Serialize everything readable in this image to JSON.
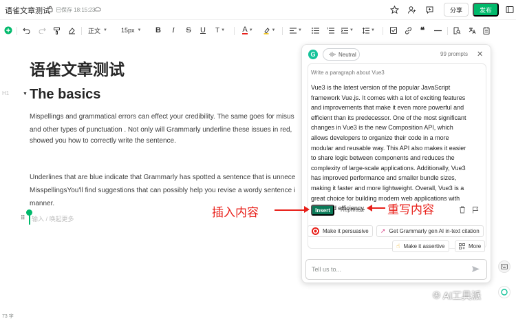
{
  "topbar": {
    "doc_title": "语雀文章测试",
    "saved_label": "已保存 18:15:23",
    "share_label": "分享",
    "publish_label": "发布"
  },
  "toolbar": {
    "paragraph_style": "正文",
    "font_size": "15px"
  },
  "editor": {
    "h1": "语雀文章测试",
    "h1_marker": "H1",
    "h2": "The basics",
    "para1": [
      "Mispellings and grammatical errors can effect your credibility. The same goes for misus",
      "and other types of punctuation . Not only will Grammarly underline these issues in red,",
      "showed you how to correctly write the sentence."
    ],
    "para2": [
      "Underlines that are blue indicate that Grammarly has spotted a sentence that is unnece",
      "MisspellingsYou'll find suggestions that can possibly help you revise a wordy sentence i",
      "manner."
    ],
    "placeholder": "输入 / 唤起更多",
    "word_count": "73 字"
  },
  "grammarly": {
    "tone_label": "Neutral",
    "prompts_left": "99 prompts",
    "prompt": "Write a paragraph about Vue3",
    "answer_lines": [
      "Vue3 is the latest version of the popular JavaScript",
      "framework Vue.js. It comes with a lot of exciting features",
      "and improvements that make it even more powerful and",
      "efficient than its predecessor. One of the most significant",
      "changes in Vue3 is the new Composition API, which",
      "allows developers to organize their code in a more",
      "modular and reusable way. This API also makes it easier",
      "to share logic between components and reduces the",
      "complexity of large-scale applications. Additionally, Vue3",
      "has improved performance and smaller bundle sizes,",
      "making it faster and more lightweight. Overall, Vue3 is a",
      "great choice for building modern web applications with",
      "ease and efficiency."
    ],
    "insert_label": "Insert",
    "rephrase_label": "Rephrase",
    "chips": {
      "persuasive": "Make it persuasive",
      "citation": "Get Grammarly gen AI in-text citation",
      "assertive": "Make it assertive",
      "more": "More"
    },
    "input_placeholder": "Tell us to..."
  },
  "annotations": {
    "insert_note": "插入内容",
    "rephrase_note": "重写内容"
  },
  "watermark": "AI工具派",
  "colors": {
    "accent_green": "#00b96b",
    "grammarly_green": "#15c39a",
    "insert_green": "#0b7a58",
    "annotation_red": "#e8201a"
  }
}
